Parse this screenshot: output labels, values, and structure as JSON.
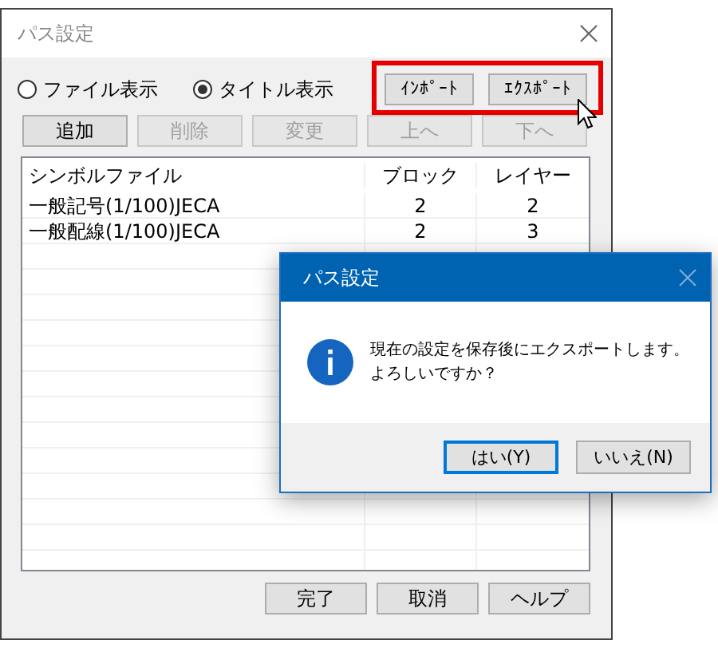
{
  "main_window": {
    "title": "パス設定",
    "view_options": [
      {
        "label": "ファイル表示",
        "selected": false
      },
      {
        "label": "タイトル表示",
        "selected": true
      }
    ],
    "transfer_buttons": {
      "highlighted": true,
      "buttons": [
        {
          "label": "ｲﾝﾎﾟｰﾄ"
        },
        {
          "label": "ｴｸｽﾎﾟｰﾄ"
        }
      ]
    },
    "edit_buttons": [
      {
        "label": "追加",
        "disabled": false
      },
      {
        "label": "削除",
        "disabled": true
      },
      {
        "label": "変更",
        "disabled": true
      },
      {
        "label": "上へ",
        "disabled": true
      },
      {
        "label": "下へ",
        "disabled": true
      }
    ],
    "table": {
      "columns": [
        "シンボルファイル",
        "ブロック",
        "レイヤー"
      ],
      "rows": [
        [
          "一般記号(1/100)JECA",
          "2",
          "2"
        ],
        [
          "一般配線(1/100)JECA",
          "2",
          "3"
        ]
      ]
    },
    "footer_buttons": [
      "完了",
      "取消",
      "ヘルプ"
    ]
  },
  "dialog": {
    "title": "パス設定",
    "message_lines": [
      "現在の設定を保存後にエクスポートします。",
      "よろしいですか？"
    ],
    "buttons": [
      {
        "label": "はい(Y)",
        "focused": true
      },
      {
        "label": "いいえ(N)",
        "focused": false
      }
    ]
  }
}
